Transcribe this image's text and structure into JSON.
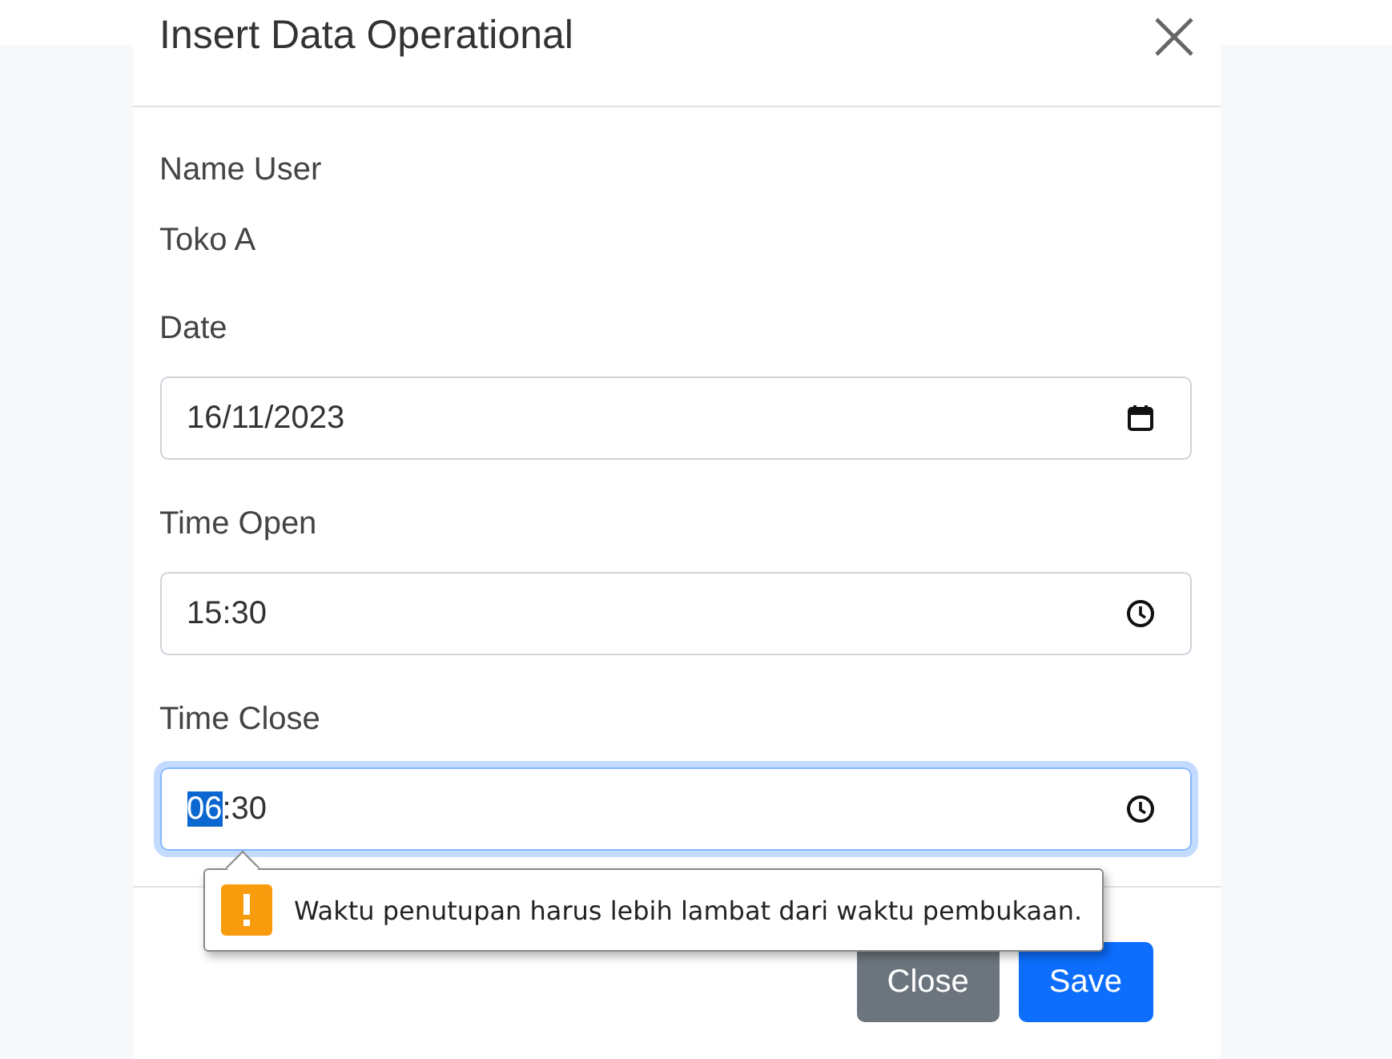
{
  "dialog": {
    "title": "Insert Data Operational"
  },
  "info": {
    "label": "Name User",
    "value": "Toko A"
  },
  "fields": [
    {
      "label": "Date",
      "kind": "date",
      "focused": false,
      "value_parts": [
        {
          "text": "16/11/2023",
          "selected": false
        }
      ]
    },
    {
      "label": "Time Open",
      "kind": "time",
      "focused": false,
      "value_parts": [
        {
          "text": "15:30",
          "selected": false
        }
      ]
    },
    {
      "label": "Time Close",
      "kind": "time",
      "focused": true,
      "value_parts": [
        {
          "text": "06",
          "selected": true
        },
        {
          "text": ":30",
          "selected": false
        }
      ]
    }
  ],
  "validation_tooltip": {
    "message": "Waktu penutupan harus lebih lambat dari waktu pembukaan."
  },
  "buttons": [
    {
      "label": "Close",
      "kind": "secondary"
    },
    {
      "label": "Save",
      "kind": "primary"
    }
  ]
}
